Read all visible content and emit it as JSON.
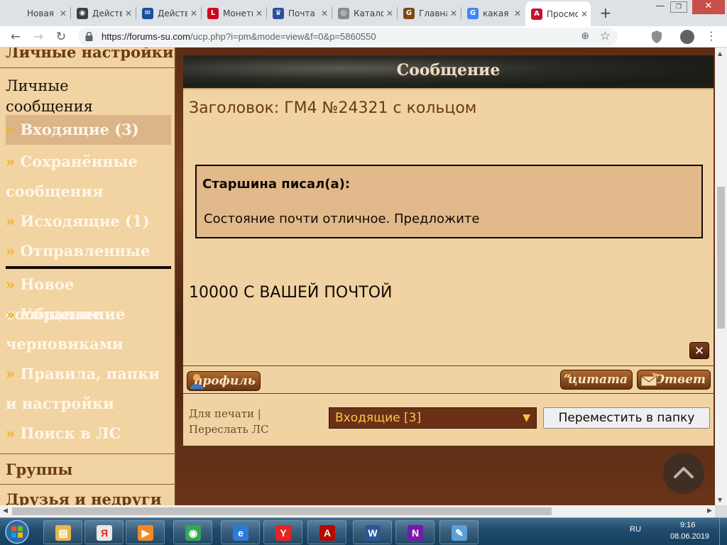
{
  "browser": {
    "tabs": [
      {
        "title": "Новая вкладка",
        "favicon": "page-icon",
        "color": "#5f6368",
        "glyph": ""
      },
      {
        "title": "Действия",
        "favicon": "globe-icon",
        "color": "#3c4043",
        "glyph": "◉"
      },
      {
        "title": "Действия",
        "favicon": "mail-logo-icon",
        "color": "#1a4f9c",
        "glyph": "✉"
      },
      {
        "title": "Монеты",
        "favicon": "l-logo-icon",
        "color": "#d0021b",
        "glyph": "L"
      },
      {
        "title": "Почта",
        "favicon": "eagle-icon",
        "color": "#2a4f9c",
        "glyph": "♛"
      },
      {
        "title": "Каталог",
        "favicon": "coin-icon",
        "color": "#8a8a8a",
        "glyph": "◎"
      },
      {
        "title": "Главная",
        "favicon": "g-logo-icon",
        "color": "#7a4a12",
        "glyph": "G"
      },
      {
        "title": "какая",
        "favicon": "google-icon",
        "color": "#4285f4",
        "glyph": "G"
      },
      {
        "title": "Просмотр",
        "favicon": "forum-a-icon",
        "color": "#c8102e",
        "glyph": "A"
      }
    ],
    "active_tab": 8,
    "url_host": "https://forums-su.com",
    "url_path": "/ucp.php?i=pm&mode=view&f=0&p=5860550"
  },
  "sidebar": {
    "top_heading": "Личные настройки",
    "pm_heading_line1": "Личные",
    "pm_heading_line2": "сообщения",
    "raquo": "»",
    "items": [
      {
        "label": "Входящие (3)"
      },
      {
        "label": "Сохранённые"
      },
      {
        "label": "сообщения"
      },
      {
        "label": "Исходящие (1)"
      },
      {
        "label": "Отправленные"
      },
      {
        "label": "Новое сообщение"
      },
      {
        "label": "Управление"
      },
      {
        "label": "черновиками"
      },
      {
        "label": "Правила, папки"
      },
      {
        "label": "и настройки"
      },
      {
        "label": "Поиск в ЛС"
      }
    ],
    "groups_heading": "Группы",
    "friends_heading": "Друзья и недруги"
  },
  "message": {
    "header_title": "Сообщение",
    "subject": "Заголовок: ГМ4 №24321 с кольцом",
    "quote_author": "Старшина писал(а):",
    "quote_text": "Состояние почти отличное. Предложите",
    "body": "10000 С ВАШЕЙ ПОЧТОЙ",
    "delete_glyph": "✕",
    "profile_label": "профиль",
    "quote_label": "цитата",
    "reply_label": "Ответ"
  },
  "footer": {
    "print_link": "Для печати",
    "separator": "|",
    "forward_link": "Переслать ЛС",
    "folder_value": "Входящие [3]",
    "move_button": "Переместить в папку"
  },
  "taskbar": {
    "apps": [
      {
        "name": "explorer-task-icon",
        "color": "#e8b84a",
        "glyph": "▤"
      },
      {
        "name": "yandex-browser-task-icon",
        "color": "#e8e8e8",
        "glyph": "Я"
      },
      {
        "name": "media-player-task-icon",
        "color": "#f08a24",
        "glyph": "▶"
      },
      {
        "name": "chrome-task-icon",
        "color": "#34a853",
        "glyph": "◉"
      },
      {
        "name": "internet-explorer-task-icon",
        "color": "#2a7ad8",
        "glyph": "e"
      },
      {
        "name": "yandex-task-icon",
        "color": "#e52620",
        "glyph": "Y"
      },
      {
        "name": "acrobat-task-icon",
        "color": "#b30b00",
        "glyph": "A"
      },
      {
        "name": "word-task-icon",
        "color": "#2b579a",
        "glyph": "W"
      },
      {
        "name": "onenote-task-icon",
        "color": "#7719aa",
        "glyph": "N"
      },
      {
        "name": "paint-task-icon",
        "color": "#5aa0d8",
        "glyph": "✎"
      }
    ],
    "language": "RU",
    "time": "9:16",
    "date": "08.06.2019"
  }
}
